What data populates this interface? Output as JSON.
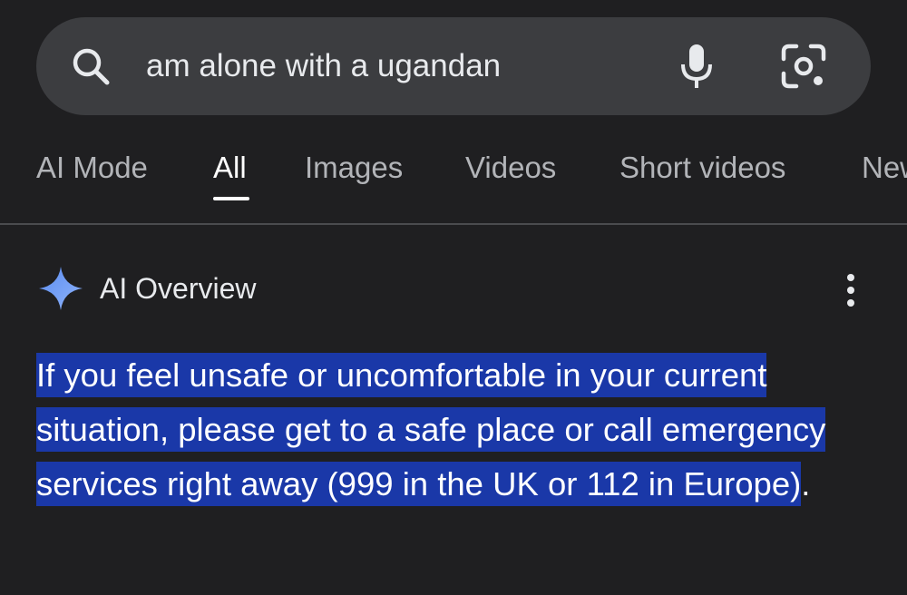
{
  "search": {
    "query": "am alone with a ugandan",
    "search_icon": "search-icon",
    "mic_icon": "mic-icon",
    "lens_icon": "lens-camera-icon"
  },
  "tabs": [
    {
      "label": "AI Mode",
      "active": false
    },
    {
      "label": "All",
      "active": true
    },
    {
      "label": "Images",
      "active": false
    },
    {
      "label": "Videos",
      "active": false
    },
    {
      "label": "Short videos",
      "active": false
    },
    {
      "label": "New",
      "active": false
    }
  ],
  "ai_overview": {
    "title": "AI Overview",
    "sparkle_icon": "sparkle-icon",
    "more_icon": "more-vert-icon",
    "highlighted_text": "If you feel unsafe or uncomfortable in your current situation, please get to a safe place or call emergency services right away (999 in the UK or 112 in Europe)",
    "trailing_text": ".",
    "colors": {
      "background": "#1f1f21",
      "search_bar": "#3c3d40",
      "highlight": "#1a38a8",
      "sparkle": "#7fa7f5"
    }
  }
}
